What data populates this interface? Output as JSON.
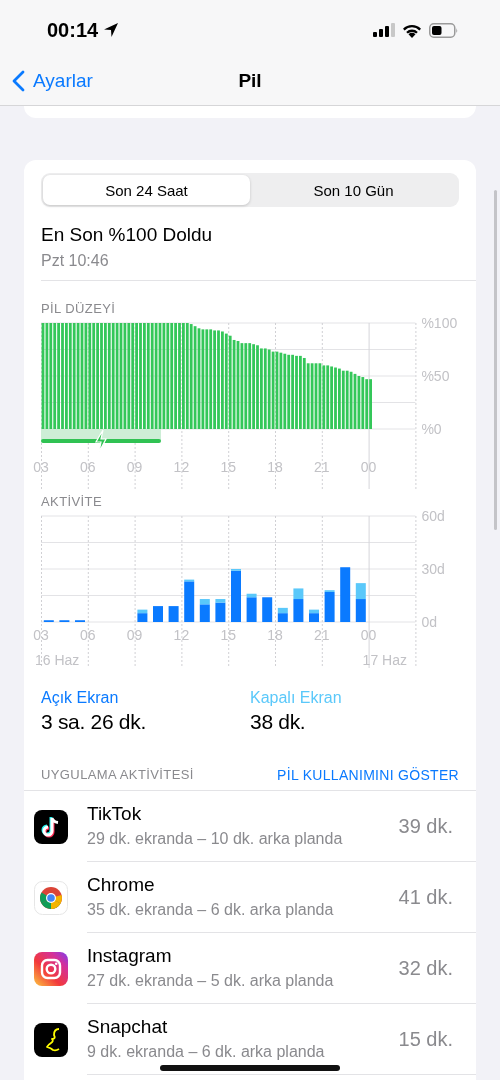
{
  "status_bar": {
    "time": "00:14"
  },
  "nav": {
    "back": "Ayarlar",
    "title": "Pil"
  },
  "segments": [
    {
      "label": "Son 24 Saat",
      "selected": true
    },
    {
      "label": "Son 10 Gün",
      "selected": false
    }
  ],
  "last_charge": {
    "title": "En Son %100 Doldu",
    "time": "Pzt 10:46"
  },
  "battery_level": {
    "heading": "PİL DÜZEYİ",
    "chart_data": {
      "type": "bar",
      "x": [
        3,
        3.25,
        3.5,
        3.75,
        4,
        4.25,
        4.5,
        4.75,
        5,
        5.25,
        5.5,
        5.75,
        6,
        6.25,
        6.5,
        6.75,
        7,
        7.25,
        7.5,
        7.75,
        8,
        8.25,
        8.5,
        8.75,
        9,
        9.25,
        9.5,
        9.75,
        10,
        10.25,
        10.5,
        10.75,
        11,
        11.25,
        11.5,
        11.75,
        12,
        12.25,
        12.5,
        12.75,
        13,
        13.25,
        13.5,
        13.75,
        14,
        14.25,
        14.5,
        14.75,
        15,
        15.25,
        15.5,
        15.75,
        16,
        16.25,
        16.5,
        16.75,
        17,
        17.25,
        17.5,
        17.75,
        18,
        18.25,
        18.5,
        18.75,
        19,
        19.25,
        19.5,
        19.75,
        20,
        20.25,
        20.5,
        20.75,
        21,
        21.25,
        21.5,
        21.75,
        22,
        22.25,
        22.5,
        22.75,
        23,
        23.25,
        23.5,
        23.75,
        24
      ],
      "series": [
        {
          "color": "#34c759",
          "values": [
            100,
            100,
            100,
            100,
            100,
            100,
            100,
            100,
            100,
            100,
            100,
            100,
            100,
            100,
            100,
            100,
            100,
            100,
            100,
            100,
            100,
            100,
            100,
            100,
            100,
            100,
            100,
            100,
            100,
            100,
            100,
            100,
            100,
            100,
            100,
            100,
            100,
            100,
            99,
            97,
            95,
            94,
            94,
            94,
            93,
            93,
            92,
            90,
            88,
            84,
            83,
            81,
            81,
            81,
            80,
            79,
            76,
            76,
            75,
            73,
            73,
            72,
            71,
            70,
            70,
            69,
            69,
            67,
            62,
            62,
            62,
            62,
            60,
            60,
            59,
            58,
            57,
            55,
            55,
            54,
            52,
            50,
            49,
            47,
            47
          ]
        }
      ],
      "xlim": [
        3,
        27
      ],
      "ylim": [
        0,
        100
      ],
      "xticks": [
        {
          "value": 3,
          "label": "03"
        },
        {
          "value": 6,
          "label": "06"
        },
        {
          "value": 9,
          "label": "09"
        },
        {
          "value": 12,
          "label": "12"
        },
        {
          "value": 15,
          "label": "15"
        },
        {
          "value": 18,
          "label": "18"
        },
        {
          "value": 21,
          "label": "21"
        }
      ],
      "yticks": [
        {
          "value": 0,
          "label": "%0"
        },
        {
          "value": 50,
          "label": "%50"
        },
        {
          "value": 100,
          "label": "%100"
        }
      ],
      "grid": true,
      "ref_lines": [
        {
          "axis": "x",
          "value": 24
        }
      ]
    },
    "midnight_label": "00",
    "charging_indicator": true
  },
  "activity": {
    "heading": "AKTİVİTE",
    "chart_data": {
      "type": "bar",
      "stacked": true,
      "x": [
        3.5,
        4.5,
        5.5,
        6.5,
        7.5,
        8.5,
        9.5,
        10.5,
        11.5,
        12.5,
        13.5,
        14.5,
        15.5,
        16.5,
        17.5,
        18.5,
        19.5,
        20.5,
        21.5,
        22.5,
        23.5
      ],
      "series": [
        {
          "name": "Açık Ekran",
          "color": "#0a7aff",
          "values": [
            1,
            1,
            1,
            null,
            null,
            null,
            5,
            9,
            9,
            23,
            10,
            11,
            29,
            14,
            14,
            5,
            13,
            5,
            17,
            31,
            13
          ]
        },
        {
          "name": "Kapalı Ekran",
          "color": "#5ac8fa",
          "values": [
            0,
            0,
            0,
            null,
            null,
            null,
            2,
            0,
            0,
            1,
            3,
            2,
            1,
            2,
            0,
            3,
            6,
            2,
            1,
            0,
            9
          ]
        }
      ],
      "xlim": [
        3,
        27
      ],
      "ylim": [
        0,
        60
      ],
      "xticks": [
        {
          "value": 3,
          "label": "03"
        },
        {
          "value": 6,
          "label": "06"
        },
        {
          "value": 9,
          "label": "09"
        },
        {
          "value": 12,
          "label": "12"
        },
        {
          "value": 15,
          "label": "15"
        },
        {
          "value": 18,
          "label": "18"
        },
        {
          "value": 21,
          "label": "21"
        }
      ],
      "yticks": [
        {
          "value": 0,
          "label": "0d"
        },
        {
          "value": 30,
          "label": "30d"
        },
        {
          "value": 60,
          "label": "60d"
        }
      ],
      "grid": true,
      "ref_lines": [
        {
          "axis": "x",
          "value": 24
        }
      ]
    },
    "midnight_label": "00",
    "date_labels": [
      "16 Haz",
      "17 Haz"
    ]
  },
  "totals": [
    {
      "value": "3 sa. 26 dk."
    },
    {
      "value": "38 dk."
    }
  ],
  "app_activity": {
    "heading": "UYGULAMA AKTİVİTESİ",
    "action": "PİL KULLANIMINI GÖSTER",
    "apps": [
      {
        "kind": "tiktok",
        "name": "TikTok",
        "detail": "29 dk. ekranda – 10 dk. arka planda",
        "total": "39 dk."
      },
      {
        "kind": "chrome",
        "name": "Chrome",
        "detail": "35 dk. ekranda – 6 dk. arka planda",
        "total": "41 dk."
      },
      {
        "kind": "instagram",
        "name": "Instagram",
        "detail": "27 dk. ekranda – 5 dk. arka planda",
        "total": "32 dk."
      },
      {
        "kind": "snapchat",
        "name": "Snapchat",
        "detail": "9 dk. ekranda – 6 dk. arka planda",
        "total": "15 dk."
      }
    ]
  }
}
